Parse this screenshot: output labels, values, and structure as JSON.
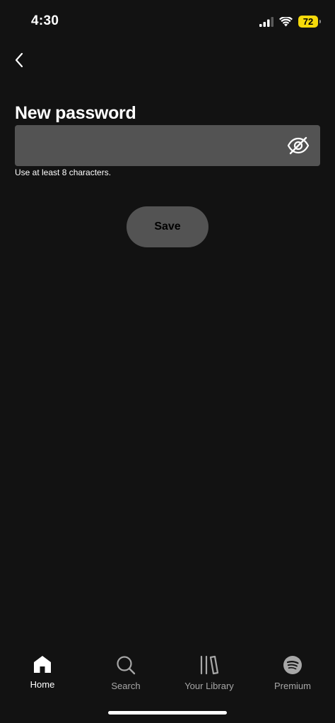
{
  "status_bar": {
    "time": "4:30",
    "battery": "72"
  },
  "header": {
    "title": "New password"
  },
  "password": {
    "value": "",
    "placeholder": "",
    "hint": "Use at least 8 characters."
  },
  "actions": {
    "save_label": "Save"
  },
  "nav": {
    "items": [
      {
        "label": "Home",
        "icon": "home-icon"
      },
      {
        "label": "Search",
        "icon": "search-icon"
      },
      {
        "label": "Your Library",
        "icon": "library-icon"
      },
      {
        "label": "Premium",
        "icon": "spotify-icon"
      }
    ]
  },
  "colors": {
    "background": "#121212",
    "field": "#535353",
    "battery": "#f5d90a"
  }
}
